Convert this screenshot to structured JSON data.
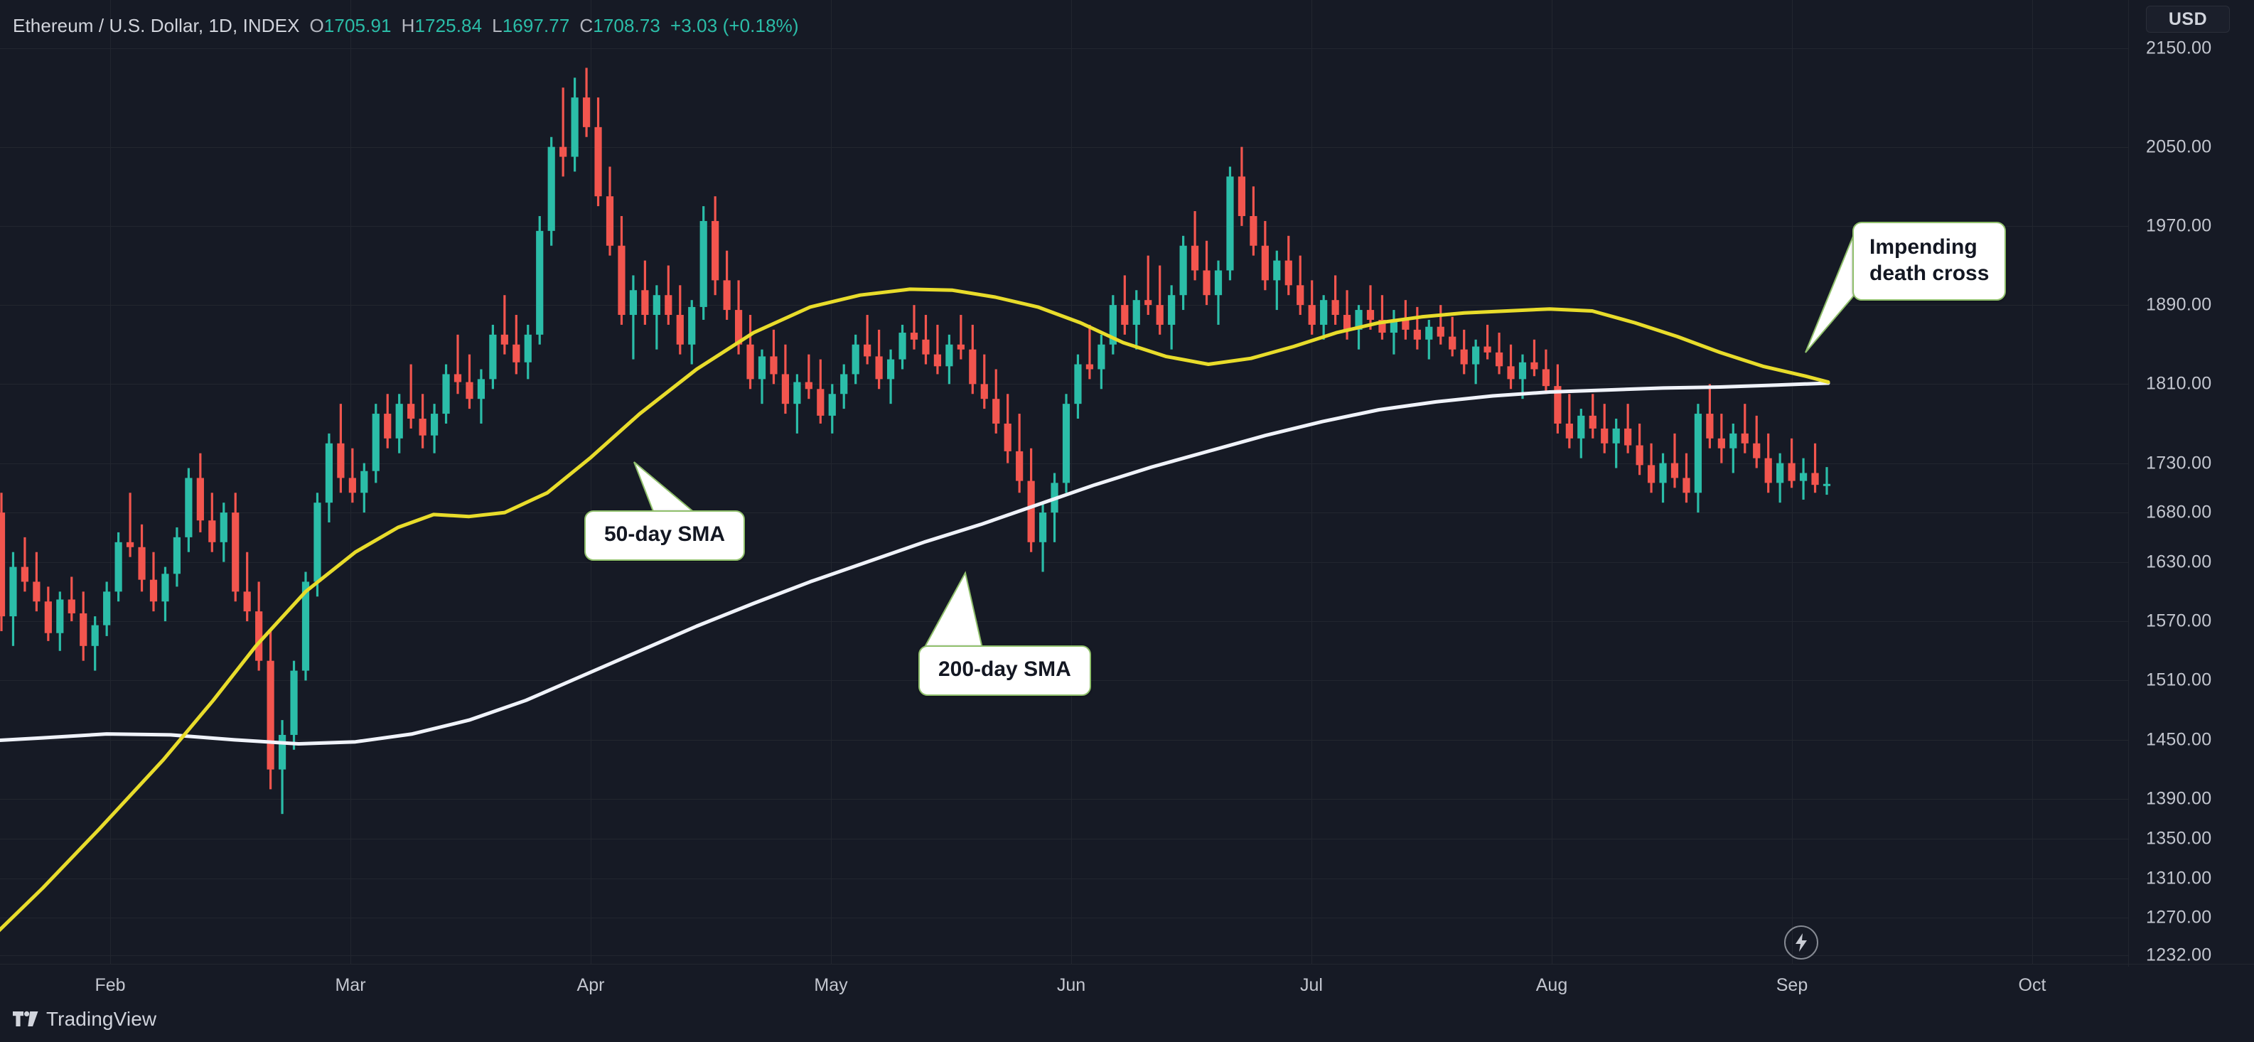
{
  "header": {
    "symbol": "Ethereum / U.S. Dollar, 1D, INDEX",
    "open_label": "O",
    "open": "1705.91",
    "high_label": "H",
    "high": "1725.84",
    "low_label": "L",
    "low": "1697.77",
    "close_label": "C",
    "close": "1708.73",
    "change": "+3.03 (+0.18%)"
  },
  "price_axis": {
    "currency_badge": "USD",
    "ticks": [
      "2150.00",
      "2050.00",
      "1970.00",
      "1890.00",
      "1810.00",
      "1730.00",
      "1680.00",
      "1630.00",
      "1570.00",
      "1510.00",
      "1450.00",
      "1390.00",
      "1350.00",
      "1310.00",
      "1270.00",
      "1232.00"
    ]
  },
  "time_axis": {
    "ticks": [
      "Feb",
      "Mar",
      "Apr",
      "May",
      "Jun",
      "Jul",
      "Aug",
      "Sep",
      "Oct"
    ]
  },
  "annotations": {
    "death_cross": "Impending\ndeath cross",
    "sma50": "50-day SMA",
    "sma200": "200-day SMA"
  },
  "icons": {
    "events": "lightning-bolt-icon"
  },
  "brand": {
    "name": "TradingView"
  },
  "colors": {
    "background": "#161A25",
    "grid": "#22262F",
    "up_candle": "#2BBDA8",
    "down_candle": "#F2554E",
    "sma50": "#E8DC2B",
    "sma200": "#F0F3FA",
    "callout_border": "#8FBF6B",
    "text": "#C3C6CF"
  },
  "chart_data": {
    "type": "candlestick",
    "title": "Ethereum / U.S. Dollar, 1D, INDEX",
    "xlabel": "",
    "ylabel": "USD",
    "ylim": [
      1232,
      2190
    ],
    "grid": true,
    "legend": "none",
    "x_tick_labels": [
      "Feb",
      "Mar",
      "Apr",
      "May",
      "Jun",
      "Jul",
      "Aug",
      "Sep",
      "Oct"
    ],
    "y_tick_labels": [
      "2150.00",
      "2050.00",
      "1970.00",
      "1890.00",
      "1810.00",
      "1730.00",
      "1680.00",
      "1630.00",
      "1570.00",
      "1510.00",
      "1450.00",
      "1390.00",
      "1350.00",
      "1310.00",
      "1270.00",
      "1232.00"
    ],
    "series": [
      {
        "name": "50-day SMA",
        "color": "#E8DC2B",
        "type": "line"
      },
      {
        "name": "200-day SMA",
        "color": "#F0F3FA",
        "type": "line"
      }
    ],
    "ohlc": [
      [
        1680,
        1700,
        1560,
        1575
      ],
      [
        1575,
        1640,
        1545,
        1625
      ],
      [
        1625,
        1655,
        1600,
        1610
      ],
      [
        1610,
        1640,
        1580,
        1590
      ],
      [
        1590,
        1605,
        1550,
        1558
      ],
      [
        1558,
        1600,
        1540,
        1592
      ],
      [
        1592,
        1615,
        1570,
        1578
      ],
      [
        1578,
        1600,
        1530,
        1545
      ],
      [
        1545,
        1575,
        1520,
        1566
      ],
      [
        1566,
        1610,
        1555,
        1600
      ],
      [
        1600,
        1660,
        1590,
        1650
      ],
      [
        1650,
        1700,
        1635,
        1645
      ],
      [
        1645,
        1668,
        1600,
        1612
      ],
      [
        1612,
        1640,
        1580,
        1590
      ],
      [
        1590,
        1625,
        1570,
        1618
      ],
      [
        1618,
        1665,
        1605,
        1655
      ],
      [
        1655,
        1725,
        1640,
        1715
      ],
      [
        1715,
        1740,
        1660,
        1672
      ],
      [
        1672,
        1700,
        1640,
        1650
      ],
      [
        1650,
        1690,
        1630,
        1680
      ],
      [
        1680,
        1700,
        1590,
        1600
      ],
      [
        1600,
        1640,
        1570,
        1580
      ],
      [
        1580,
        1610,
        1520,
        1530
      ],
      [
        1530,
        1560,
        1400,
        1420
      ],
      [
        1420,
        1470,
        1375,
        1455
      ],
      [
        1455,
        1530,
        1440,
        1520
      ],
      [
        1520,
        1620,
        1510,
        1610
      ],
      [
        1610,
        1700,
        1595,
        1690
      ],
      [
        1690,
        1760,
        1670,
        1750
      ],
      [
        1750,
        1790,
        1700,
        1715
      ],
      [
        1715,
        1745,
        1690,
        1700
      ],
      [
        1700,
        1730,
        1680,
        1722
      ],
      [
        1722,
        1790,
        1710,
        1780
      ],
      [
        1780,
        1800,
        1745,
        1755
      ],
      [
        1755,
        1800,
        1740,
        1790
      ],
      [
        1790,
        1830,
        1765,
        1775
      ],
      [
        1775,
        1800,
        1745,
        1758
      ],
      [
        1758,
        1790,
        1740,
        1780
      ],
      [
        1780,
        1830,
        1770,
        1820
      ],
      [
        1820,
        1860,
        1800,
        1812
      ],
      [
        1812,
        1840,
        1785,
        1795
      ],
      [
        1795,
        1825,
        1770,
        1815
      ],
      [
        1815,
        1870,
        1805,
        1860
      ],
      [
        1860,
        1900,
        1840,
        1850
      ],
      [
        1850,
        1880,
        1820,
        1832
      ],
      [
        1832,
        1870,
        1815,
        1860
      ],
      [
        1860,
        1980,
        1850,
        1965
      ],
      [
        1965,
        2060,
        1950,
        2050
      ],
      [
        2050,
        2110,
        2020,
        2040
      ],
      [
        2040,
        2120,
        2025,
        2100
      ],
      [
        2100,
        2130,
        2060,
        2070
      ],
      [
        2070,
        2100,
        1990,
        2000
      ],
      [
        2000,
        2030,
        1940,
        1950
      ],
      [
        1950,
        1980,
        1870,
        1880
      ],
      [
        1880,
        1920,
        1835,
        1905
      ],
      [
        1905,
        1935,
        1870,
        1880
      ],
      [
        1880,
        1910,
        1845,
        1900
      ],
      [
        1900,
        1930,
        1870,
        1880
      ],
      [
        1880,
        1910,
        1840,
        1850
      ],
      [
        1850,
        1895,
        1830,
        1888
      ],
      [
        1888,
        1990,
        1875,
        1975
      ],
      [
        1975,
        2000,
        1900,
        1915
      ],
      [
        1915,
        1945,
        1875,
        1885
      ],
      [
        1885,
        1915,
        1840,
        1850
      ],
      [
        1850,
        1880,
        1805,
        1815
      ],
      [
        1815,
        1845,
        1790,
        1838
      ],
      [
        1838,
        1865,
        1810,
        1820
      ],
      [
        1820,
        1850,
        1780,
        1790
      ],
      [
        1790,
        1820,
        1760,
        1812
      ],
      [
        1812,
        1840,
        1795,
        1805
      ],
      [
        1805,
        1835,
        1770,
        1778
      ],
      [
        1778,
        1810,
        1760,
        1800
      ],
      [
        1800,
        1830,
        1785,
        1820
      ],
      [
        1820,
        1860,
        1810,
        1850
      ],
      [
        1850,
        1880,
        1830,
        1838
      ],
      [
        1838,
        1865,
        1805,
        1815
      ],
      [
        1815,
        1845,
        1790,
        1835
      ],
      [
        1835,
        1870,
        1825,
        1862
      ],
      [
        1862,
        1890,
        1845,
        1855
      ],
      [
        1855,
        1880,
        1830,
        1840
      ],
      [
        1840,
        1870,
        1820,
        1828
      ],
      [
        1828,
        1860,
        1810,
        1850
      ],
      [
        1850,
        1880,
        1835,
        1845
      ],
      [
        1845,
        1870,
        1800,
        1810
      ],
      [
        1810,
        1840,
        1785,
        1795
      ],
      [
        1795,
        1825,
        1760,
        1770
      ],
      [
        1770,
        1800,
        1730,
        1742
      ],
      [
        1742,
        1780,
        1700,
        1712
      ],
      [
        1712,
        1745,
        1640,
        1650
      ],
      [
        1650,
        1690,
        1620,
        1680
      ],
      [
        1680,
        1720,
        1650,
        1710
      ],
      [
        1710,
        1800,
        1700,
        1790
      ],
      [
        1790,
        1840,
        1775,
        1830
      ],
      [
        1830,
        1870,
        1815,
        1825
      ],
      [
        1825,
        1860,
        1805,
        1850
      ],
      [
        1850,
        1900,
        1840,
        1890
      ],
      [
        1890,
        1920,
        1860,
        1870
      ],
      [
        1870,
        1905,
        1845,
        1895
      ],
      [
        1895,
        1940,
        1880,
        1890
      ],
      [
        1890,
        1930,
        1860,
        1870
      ],
      [
        1870,
        1910,
        1845,
        1900
      ],
      [
        1900,
        1960,
        1885,
        1950
      ],
      [
        1950,
        1985,
        1915,
        1925
      ],
      [
        1925,
        1955,
        1890,
        1900
      ],
      [
        1900,
        1935,
        1870,
        1925
      ],
      [
        1925,
        2030,
        1915,
        2020
      ],
      [
        2020,
        2050,
        1970,
        1980
      ],
      [
        1980,
        2010,
        1940,
        1950
      ],
      [
        1950,
        1975,
        1905,
        1915
      ],
      [
        1915,
        1945,
        1885,
        1935
      ],
      [
        1935,
        1960,
        1900,
        1910
      ],
      [
        1910,
        1940,
        1880,
        1890
      ],
      [
        1890,
        1915,
        1860,
        1870
      ],
      [
        1870,
        1900,
        1855,
        1895
      ],
      [
        1895,
        1920,
        1870,
        1880
      ],
      [
        1880,
        1905,
        1855,
        1865
      ],
      [
        1865,
        1890,
        1845,
        1885
      ],
      [
        1885,
        1910,
        1865,
        1875
      ],
      [
        1875,
        1900,
        1855,
        1862
      ],
      [
        1862,
        1885,
        1840,
        1875
      ],
      [
        1875,
        1895,
        1855,
        1865
      ],
      [
        1865,
        1888,
        1845,
        1855
      ],
      [
        1855,
        1875,
        1835,
        1868
      ],
      [
        1868,
        1890,
        1850,
        1858
      ],
      [
        1858,
        1878,
        1838,
        1845
      ],
      [
        1845,
        1865,
        1820,
        1830
      ],
      [
        1830,
        1855,
        1810,
        1848
      ],
      [
        1848,
        1870,
        1835,
        1842
      ],
      [
        1842,
        1862,
        1820,
        1828
      ],
      [
        1828,
        1850,
        1805,
        1815
      ],
      [
        1815,
        1840,
        1795,
        1832
      ],
      [
        1832,
        1855,
        1818,
        1825
      ],
      [
        1825,
        1845,
        1800,
        1808
      ],
      [
        1808,
        1830,
        1760,
        1770
      ],
      [
        1770,
        1800,
        1745,
        1755
      ],
      [
        1755,
        1785,
        1735,
        1778
      ],
      [
        1778,
        1800,
        1755,
        1765
      ],
      [
        1765,
        1790,
        1740,
        1750
      ],
      [
        1750,
        1775,
        1725,
        1765
      ],
      [
        1765,
        1790,
        1740,
        1748
      ],
      [
        1748,
        1770,
        1718,
        1728
      ],
      [
        1728,
        1750,
        1700,
        1710
      ],
      [
        1710,
        1740,
        1690,
        1730
      ],
      [
        1730,
        1760,
        1705,
        1715
      ],
      [
        1715,
        1740,
        1690,
        1700
      ],
      [
        1700,
        1790,
        1680,
        1780
      ],
      [
        1780,
        1810,
        1745,
        1755
      ],
      [
        1755,
        1780,
        1730,
        1745
      ],
      [
        1745,
        1770,
        1720,
        1760
      ],
      [
        1760,
        1790,
        1740,
        1750
      ],
      [
        1750,
        1778,
        1725,
        1735
      ],
      [
        1735,
        1760,
        1700,
        1710
      ],
      [
        1710,
        1740,
        1690,
        1730
      ],
      [
        1730,
        1755,
        1705,
        1712
      ],
      [
        1712,
        1735,
        1693,
        1720
      ],
      [
        1720,
        1750,
        1700,
        1708
      ],
      [
        1708,
        1726,
        1698,
        1709
      ]
    ],
    "crash_note": "Long lower-wick sell-off candle in mid-August, followed by a recovery into September",
    "cross_note": "Yellow 50-day SMA descends to meet the white 200-day SMA at the right edge (impending death cross)"
  }
}
